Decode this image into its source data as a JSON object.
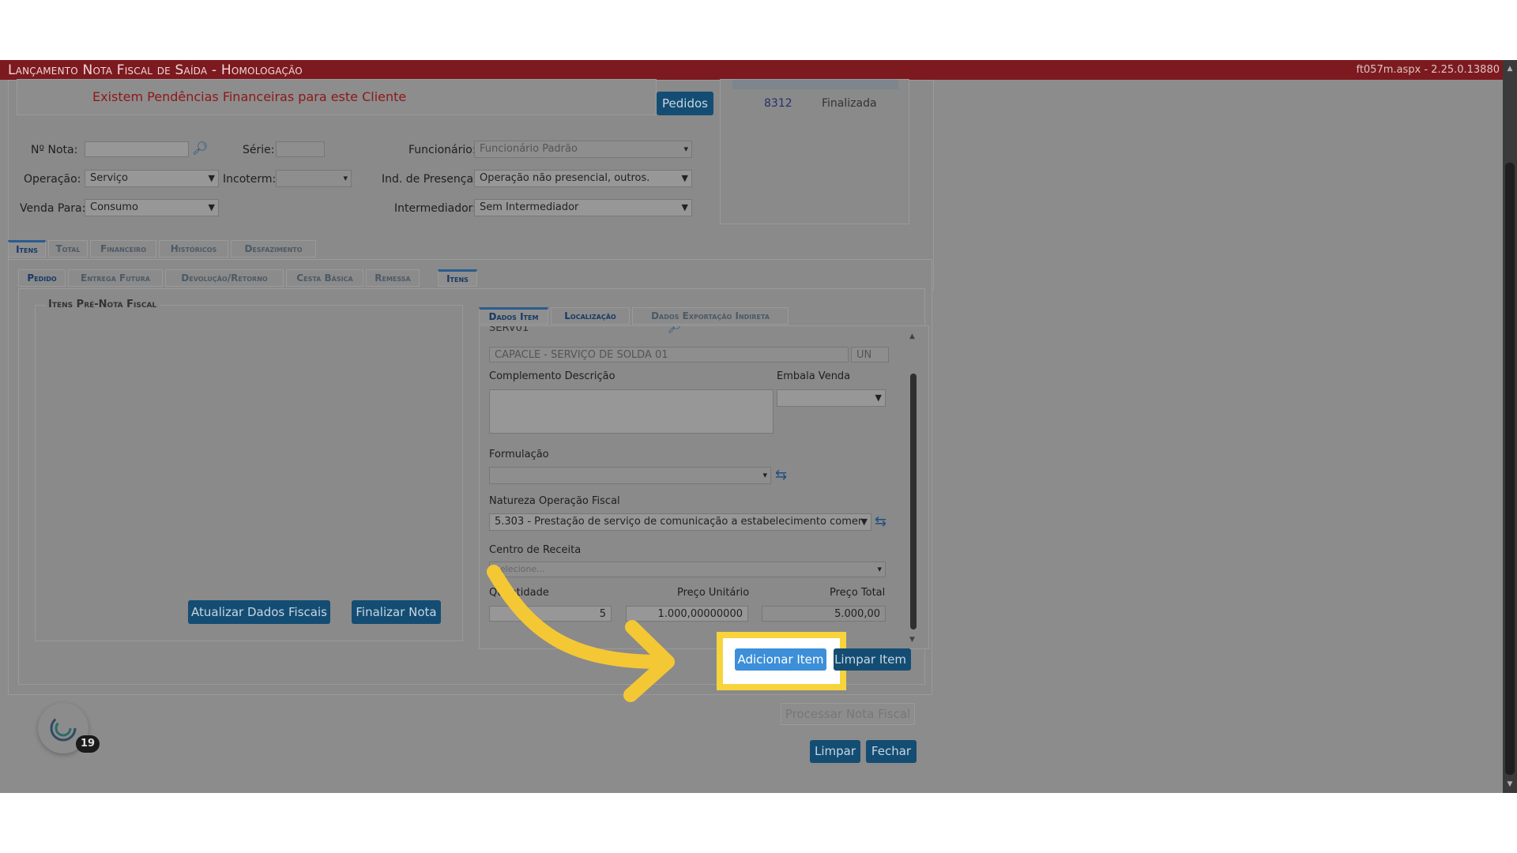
{
  "window": {
    "title": "Lançamento Nota Fiscal de Saída  - Homologação",
    "version": "ft057m.aspx - 2.25.0.13880"
  },
  "alert": {
    "text": "Existem Pendências Financeiras para este Cliente"
  },
  "pedidos_button": "Pedidos",
  "orders": [
    {
      "number": "8312",
      "status": "Finalizada"
    }
  ],
  "form": {
    "nota_label": "Nº Nota:",
    "nota_value": "",
    "serie_label": "Série:",
    "serie_value": "",
    "funcionario_label": "Funcionário:",
    "funcionario_value": "Funcionário Padrão",
    "operacao_label": "Operação:",
    "operacao_value": "Serviço",
    "incoterm_label": "Incoterm:",
    "incoterm_value": "",
    "presenca_label": "Ind. de Presença:",
    "presenca_value": "Operação não presencial, outros.",
    "venda_label": "Venda Para:",
    "venda_value": "Consumo",
    "intermediador_label": "Intermediador:",
    "intermediador_value": "Sem Intermediador"
  },
  "main_tabs": [
    "Itens",
    "Total",
    "Financeiro",
    "Históricos",
    "Desfazimento"
  ],
  "sub_tabs": [
    "Pedido",
    "Entrega Futura",
    "Devolução/Retorno",
    "Cesta Básica",
    "Remessa",
    "Itens"
  ],
  "prenota": {
    "legend": "Itens Pré-Nota Fiscal",
    "atualizar_button": "Atualizar Dados Fiscais",
    "finalizar_button": "Finalizar Nota"
  },
  "item_tabs": [
    "Dados Item",
    "Localização",
    "Dados Exportação Indireta"
  ],
  "item": {
    "code": "SERV01",
    "description": "CAPACLE - SERVIÇO DE SOLDA 01",
    "unit": "UN",
    "complemento_label": "Complemento Descrição",
    "embala_label": "Embala Venda",
    "formulacao_label": "Formulação",
    "natureza_label": "Natureza Operação Fiscal",
    "natureza_value": "5.303 - Prestação de serviço de comunicação a estabelecimento comer",
    "centro_label": "Centro de Receita",
    "centro_placeholder": "Selecione...",
    "quantidade_label": "Quantidade",
    "quantidade_value": "5",
    "preco_unit_label": "Preço Unitário",
    "preco_unit_value": "1.000,00000000",
    "preco_total_label": "Preço Total",
    "preco_total_value": "5.000,00"
  },
  "actions": {
    "adicionar": "Adicionar Item",
    "limpar_item": "Limpar Item",
    "processar": "Processar Nota Fiscal",
    "limpar": "Limpar",
    "fechar": "Fechar"
  },
  "badge_count": "19",
  "colors": {
    "highlight": "#f7d33c",
    "arrow": "#f4c735",
    "button_blue": "#3c8fd8",
    "title_bar": "#7c1a20"
  }
}
